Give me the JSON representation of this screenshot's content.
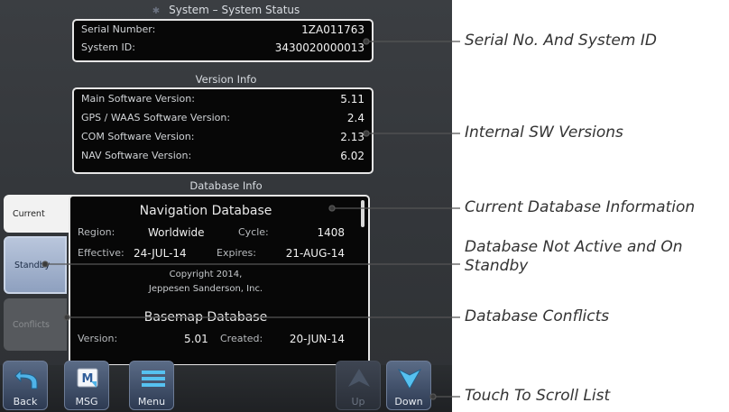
{
  "screen": {
    "title": "System – System Status",
    "identity": [
      {
        "label": "Serial Number:",
        "value": "1ZA011763"
      },
      {
        "label": "System ID:",
        "value": "3430020000013"
      }
    ],
    "version_heading": "Version Info",
    "versions": [
      {
        "label": "Main Software Version:",
        "value": "5.11"
      },
      {
        "label": "GPS / WAAS Software Version:",
        "value": "2.4"
      },
      {
        "label": "COM Software Version:",
        "value": "2.13"
      },
      {
        "label": "NAV Software Version:",
        "value": "6.02"
      }
    ],
    "database_heading": "Database Info",
    "tabs": {
      "current": "Current",
      "standby": "Standby",
      "conflicts": "Conflicts"
    },
    "nav_db": {
      "title": "Navigation Database",
      "region_label": "Region:",
      "region": "Worldwide",
      "cycle_label": "Cycle:",
      "cycle": "1408",
      "effective_label": "Effective:",
      "effective": "24-JUL-14",
      "expires_label": "Expires:",
      "expires": "21-AUG-14",
      "copyright_1": "Copyright 2014,",
      "copyright_2": "Jeppesen Sanderson, Inc."
    },
    "basemap_db": {
      "title": "Basemap Database",
      "version_label": "Version:",
      "version": "5.01",
      "created_label": "Created:",
      "created": "20-JUN-14"
    },
    "toolbar": {
      "back": "Back",
      "msg": "MSG",
      "menu": "Menu",
      "up": "Up",
      "down": "Down"
    }
  },
  "callouts": {
    "serial": "Serial No. And System ID",
    "internal_sw": "Internal SW Versions",
    "current_db": "Current Database Information",
    "standby_db": "Database Not Active and On Standby",
    "conflicts": "Database Conflicts",
    "scroll": "Touch To Scroll List"
  },
  "colors": {
    "screen_bg": "#35383c",
    "box_bg": "#070707",
    "standby_tab": "#a9b8d2",
    "button": "#3f4e6a",
    "callout_line": "#555555"
  }
}
